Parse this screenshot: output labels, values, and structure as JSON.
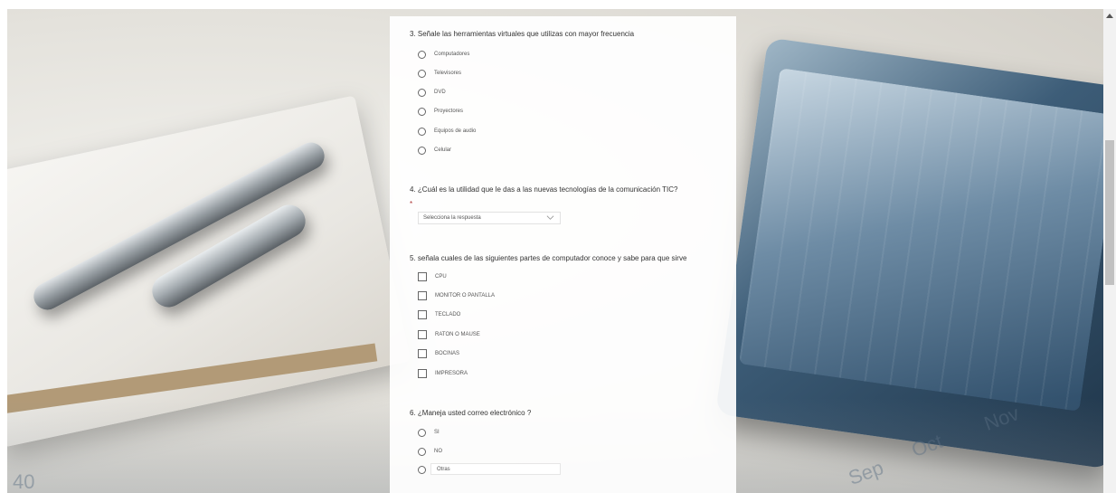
{
  "q3": {
    "title": "3. Señale las herramientas virtuales que utilizas con mayor frecuencia",
    "options": [
      "Computadores",
      "Televisores",
      "DVD",
      "Proyectores",
      "Equipos de audio",
      "Celular"
    ]
  },
  "q4": {
    "title": "4. ¿Cuál es la utilidad que le das a las nuevas tecnologías de la comunicación TIC?",
    "required_mark": "*",
    "select_placeholder": "Selecciona la respuesta"
  },
  "q5": {
    "title": "5. señala cuales de las siguientes partes de computador conoce y sabe para que sirve",
    "options": [
      "CPU",
      "MONITOR O PANTALLA",
      "TECLADO",
      "RATON O MAUSE",
      "BOCINAS",
      "IMPRESORA"
    ]
  },
  "q6": {
    "title": "6. ¿Maneja usted correo electrónico ?",
    "options": [
      "SI",
      "NO"
    ],
    "other_label": "Otras"
  },
  "background_words": [
    "40",
    "Oct",
    "Nov",
    "Sep"
  ],
  "icons": {
    "chevron": "chevron-down-icon",
    "scroll_up": "scroll-up-arrow-icon"
  },
  "colors": {
    "panel_bg": "#ffffff",
    "border": "#666666"
  }
}
